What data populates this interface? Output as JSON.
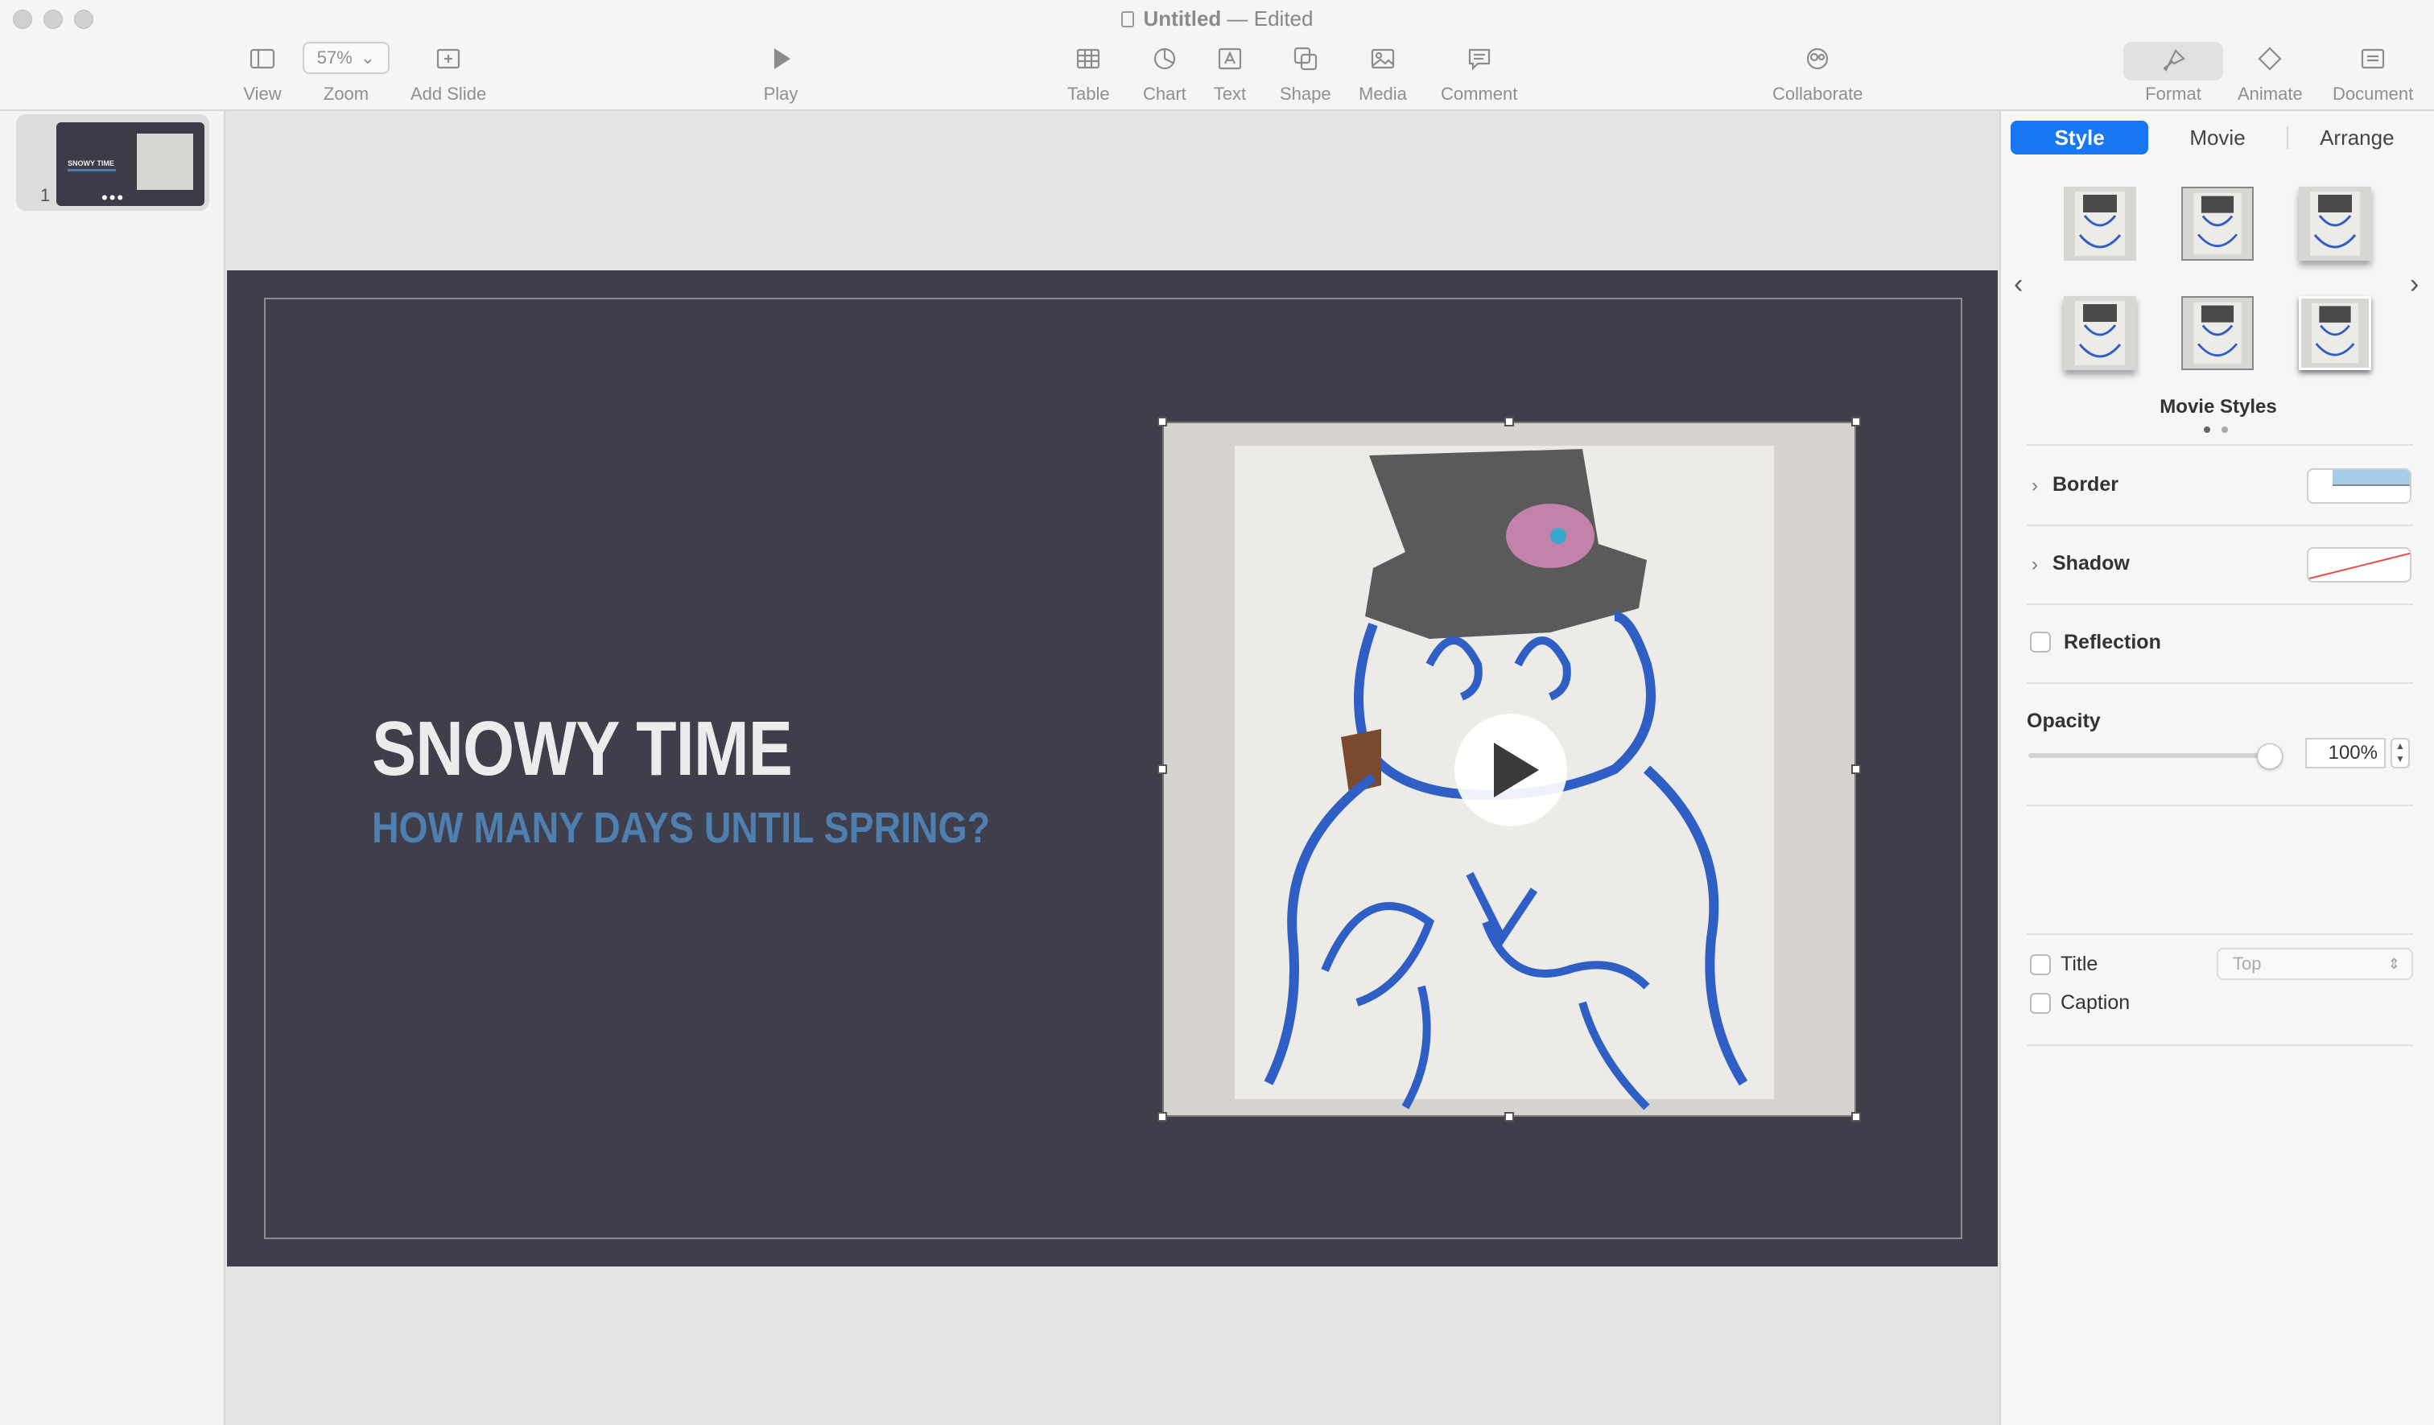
{
  "window": {
    "title": "Untitled",
    "separator": "—",
    "status": "Edited"
  },
  "toolbar": {
    "view": "View",
    "zoom_value": "57%",
    "zoom": "Zoom",
    "add_slide": "Add Slide",
    "play": "Play",
    "table": "Table",
    "chart": "Chart",
    "text": "Text",
    "shape": "Shape",
    "media": "Media",
    "comment": "Comment",
    "collaborate": "Collaborate",
    "format": "Format",
    "animate": "Animate",
    "document": "Document"
  },
  "navigator": {
    "slides": [
      {
        "number": "1",
        "dots": "•••"
      }
    ]
  },
  "slide": {
    "title": "SNOWY TIME",
    "subtitle": "HOW MANY DAYS UNTIL SPRING?"
  },
  "inspector": {
    "tabs": [
      "Style",
      "Movie",
      "Arrange"
    ],
    "active_tab": "Style",
    "movie_styles_label": "Movie Styles",
    "border": "Border",
    "shadow": "Shadow",
    "reflection": "Reflection",
    "opacity_label": "Opacity",
    "opacity_value": "100%",
    "opacity_fraction": 1.0,
    "title_label": "Title",
    "title_position": "Top",
    "caption_label": "Caption"
  },
  "colors": {
    "accent": "#1877f2",
    "slide_background": "#3f3e4b",
    "subtitle": "#4e7fae"
  }
}
